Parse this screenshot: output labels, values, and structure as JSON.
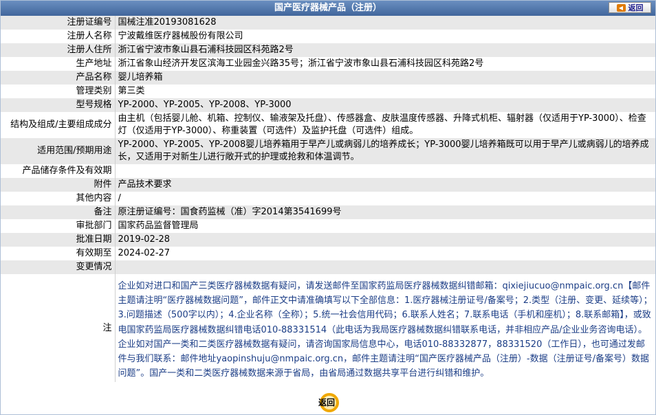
{
  "header": {
    "title": "国产医疗器械产品（注册）",
    "back_label": "返回"
  },
  "rows": [
    {
      "label": "注册证编号",
      "value": "国械注准20193081628"
    },
    {
      "label": "注册人名称",
      "value": "宁波戴维医疗器械股份有限公司"
    },
    {
      "label": "注册人住所",
      "value": "浙江省宁波市象山县石浦科技园区科苑路2号"
    },
    {
      "label": "生产地址",
      "value": "浙江省象山经济开发区滨海工业园金兴路35号；浙江省宁波市象山县石浦科技园区科苑路2号"
    },
    {
      "label": "产品名称",
      "value": "婴儿培养箱"
    },
    {
      "label": "管理类别",
      "value": "第三类"
    },
    {
      "label": "型号规格",
      "value": "YP-2000、YP-2005、YP-2008、YP-3000"
    },
    {
      "label": "结构及组成/主要组成成分",
      "value": "由主机（包括婴儿舱、机箱、控制仪、输液架及托盘）、传感器盒、皮肤温度传感器、升降式机柜、辐射器（仅适用于YP-3000）、检查灯（仅适用于YP-3000）、称重装置（可选件）及监护托盘（可选件）组成。"
    },
    {
      "label": "适用范围/预期用途",
      "value": "YP-2000、YP-2005、YP-2008婴儿培养箱用于早产儿或病弱儿的培养成长；YP-3000婴儿培养箱既可以用于早产儿或病弱儿的培养成长，又适用于对新生儿进行敞开式的护理或抢救和体温调节。"
    },
    {
      "label": "产品储存条件及有效期",
      "value": ""
    },
    {
      "label": "附件",
      "value": "产品技术要求"
    },
    {
      "label": "其他内容",
      "value": "/"
    },
    {
      "label": "备注",
      "value": "原注册证编号：国食药监械（准）字2014第3541699号"
    },
    {
      "label": "审批部门",
      "value": "国家药品监督管理局"
    },
    {
      "label": "批准日期",
      "value": "2019-02-28"
    },
    {
      "label": "有效期至",
      "value": "2024-02-27"
    },
    {
      "label": "变更情况",
      "value": ""
    }
  ],
  "note": {
    "label": "注",
    "text": "企业如对进口和国产三类医疗器械数据有疑问，请发送邮件至国家药监局医疗器械数据纠错邮箱：qixiejiucuo@nmpaic.org.cn【邮件主题请注明“医疗器械数据问题”，邮件正文中请准确填写以下全部信息：1.医疗器械注册证号/备案号；2.类型（注册、变更、延续等）；3.问题描述（500字以内）；4.企业名称（全称）；5.统一社会信用代码；6.联系人姓名；7.联系电话（手机和座机）；8.联系邮箱】，或致电国家药监局医疗器械数据纠错电话010-88331514（此电话为我局医疗器械数据纠错联系电话，并非相应产品/企业业务咨询电话）。企业如对国产一类和二类医疗器械数据有疑问，请咨询国家局信息中心，电话010-88332877，88331520（工作日），也可通过发邮件与我们联系：邮件地址yaopinshuju@nmpaic.org.cn，邮件主题请注明“国产医疗器械产品（注册）-数据（注册证号/备案号）数据问题”。国产一类和二类医疗器械数据来源于省局，由省局通过数据共享平台进行纠错和维护。"
  },
  "footer": {
    "back_label": "返回"
  }
}
